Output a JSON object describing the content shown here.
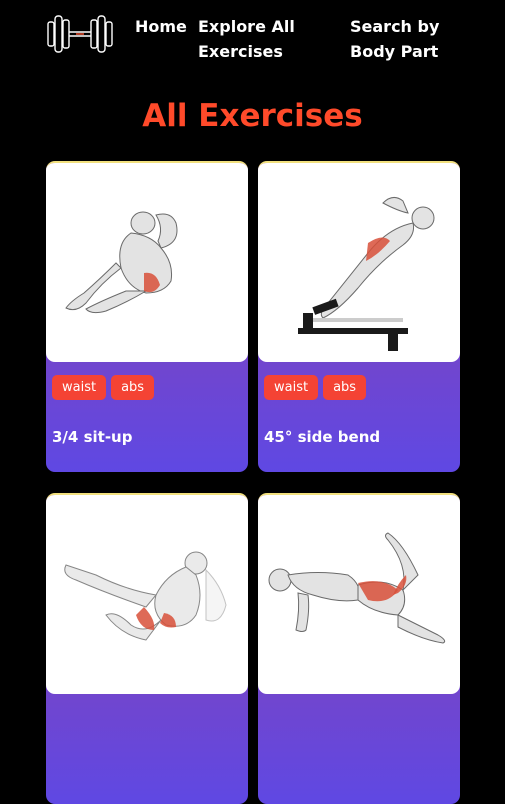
{
  "nav": {
    "logo_icon": "dumbbell-icon",
    "links": [
      {
        "label": "Home"
      },
      {
        "label": "Explore All Exercises"
      },
      {
        "label": "Search by Body Part"
      }
    ]
  },
  "page_title": "All Exercises",
  "accent_color": "#ff4a2a",
  "tag_color": "#f44334",
  "exercises": [
    {
      "name": "3/4 sit-up",
      "tags": [
        "waist",
        "abs"
      ],
      "image_icon": "sit-up-illustration"
    },
    {
      "name": "45° side bend",
      "tags": [
        "waist",
        "abs"
      ],
      "image_icon": "side-bend-illustration"
    },
    {
      "name": "",
      "tags": [],
      "image_icon": "air-bike-illustration"
    },
    {
      "name": "",
      "tags": [],
      "image_icon": "kneeling-kickback-illustration"
    }
  ]
}
